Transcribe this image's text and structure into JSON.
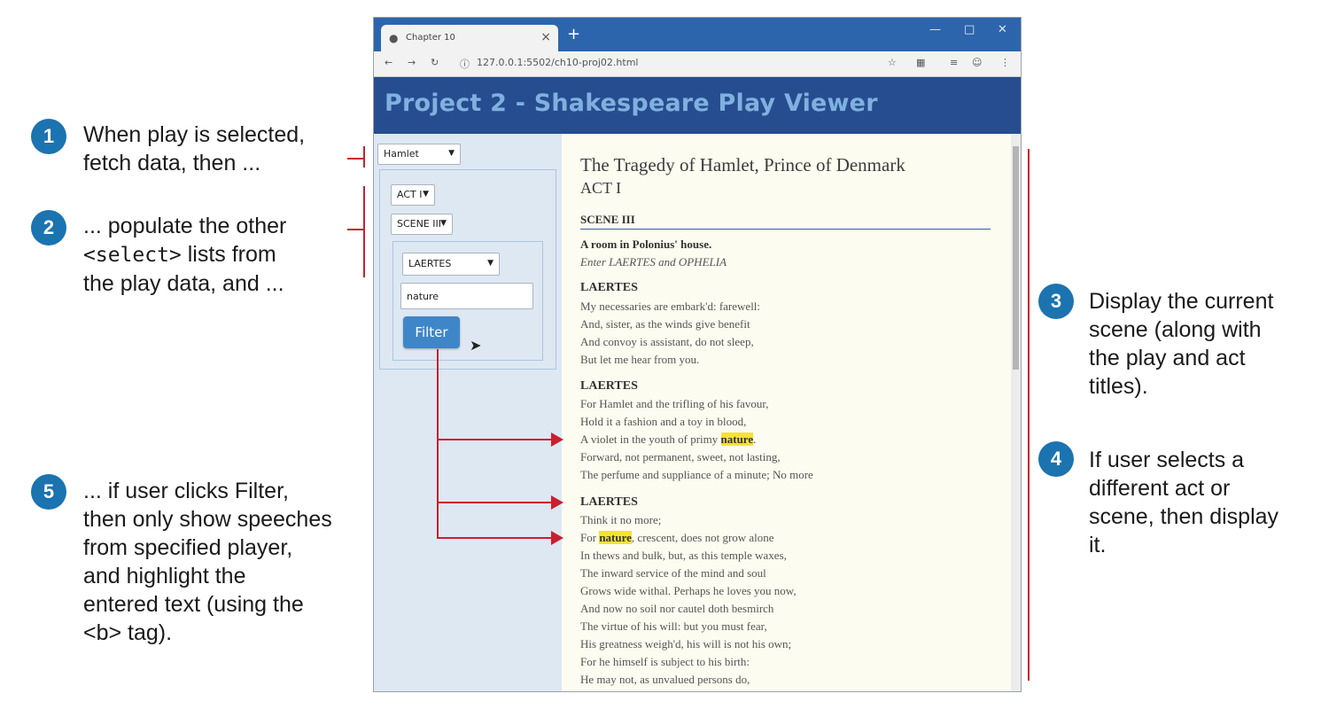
{
  "callouts": {
    "c1": {
      "num": "1",
      "text": [
        "When play is selected,",
        "fetch data, then ..."
      ]
    },
    "c2": {
      "num": "2",
      "line1": "... populate the other",
      "tag": "<select>",
      "line2_rest": " lists from",
      "line3": "the play data, and ..."
    },
    "c3": {
      "num": "3",
      "text": [
        "Display the current",
        "scene (along with",
        "the play and act",
        "titles)."
      ]
    },
    "c4": {
      "num": "4",
      "text": [
        "If user selects a",
        "different act or",
        "scene, then display",
        "it."
      ]
    },
    "c5": {
      "num": "5",
      "text": [
        "... if user clicks Filter,",
        "then only show speeches",
        "from specified player,",
        "and highlight the",
        "entered text (using the",
        "<b> tag)."
      ]
    }
  },
  "browser": {
    "tab_title": "Chapter 10",
    "url": "127.0.0.1:5502/ch10-proj02.html",
    "page_title": "Project 2 - Shakespeare Play Viewer"
  },
  "controls": {
    "play_select": "Hamlet",
    "act_select": "ACT I",
    "scene_select": "SCENE III",
    "player_select": "LAERTES",
    "filter_text": "nature",
    "filter_button": "Filter"
  },
  "content": {
    "play_title": "The Tragedy of Hamlet, Prince of Denmark",
    "act_title": "ACT I",
    "scene_title": "SCENE III",
    "scene_desc": "A room in Polonius' house.",
    "stage_dir": "Enter LAERTES and OPHELIA",
    "speaker": "LAERTES",
    "speech1": [
      "My necessaries are embark'd: farewell:",
      "And, sister, as the winds give benefit",
      "And convoy is assistant, do not sleep,",
      "But let me hear from you."
    ],
    "speech2_a": [
      "For Hamlet and the trifling of his favour,",
      "Hold it a fashion and a toy in blood,"
    ],
    "speech2_line3_pre": "A violet in the youth of primy ",
    "speech2_line3_post": ".",
    "speech2_b": [
      "Forward, not permanent, sweet, not lasting,",
      "The perfume and suppliance of a minute; No more"
    ],
    "speech3_line1": "Think it no more;",
    "speech3_line2_pre": "For ",
    "speech3_line2_post": ", crescent, does not grow alone",
    "speech3_rest": [
      "In thews and bulk, but, as this temple waxes,",
      "The inward service of the mind and soul",
      "Grows wide withal. Perhaps he loves you now,",
      "And now no soil nor cautel doth besmirch",
      "The virtue of his will: but you must fear,",
      "His greatness weigh'd, his will is not his own;",
      "For he himself is subject to his birth:",
      "He may not, as unvalued persons do,"
    ],
    "highlight_word": "nature"
  },
  "colors": {
    "badge": "#1b73b0",
    "connector": "#c8202e",
    "header": "#254d8f",
    "highlight": "#f5e332"
  }
}
